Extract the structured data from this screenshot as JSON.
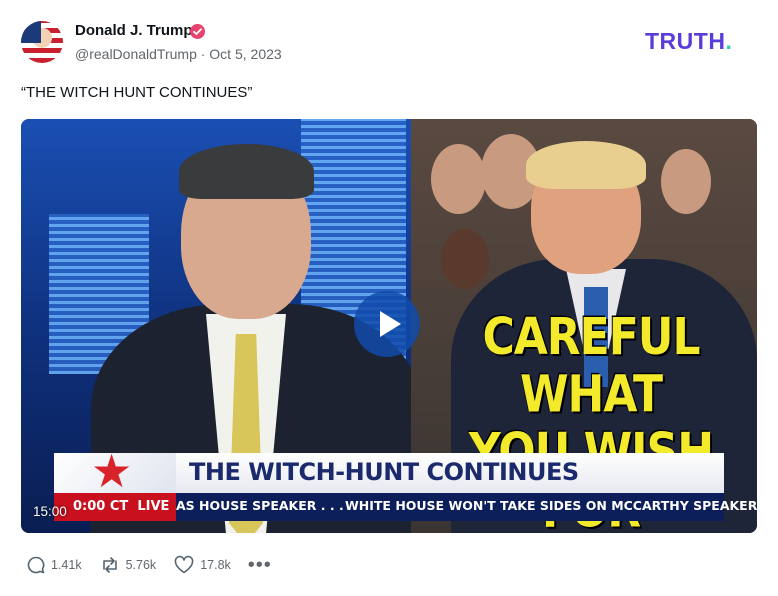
{
  "post": {
    "author_name": "Donald J. Trump",
    "handle_line": "@realDonaldTrump · Oct 5, 2023",
    "text": "“THE WITCH HUNT CONTINUES”",
    "verified_color": "#e7436f"
  },
  "brand": {
    "logo_text": "TRUTH",
    "logo_dot": ".",
    "logo_color": "#5a3dd8",
    "dot_color": "#29d3b5"
  },
  "video": {
    "duration": "15:00",
    "headline_line1": "CAREFUL WHAT",
    "headline_line2": "YOU WISH FOR",
    "banner_title": "THE WITCH-HUNT CONTINUES",
    "live_time": "0:00 CT",
    "live_label": "LIVE",
    "ticker_1": "AS HOUSE SPEAKER . . .",
    "ticker_2": "WHITE HOUSE WON'T TAKE SIDES ON MCCARTHY SPEAKERS",
    "play_icon": "play-icon"
  },
  "actions": {
    "replies": "1.41k",
    "retruths": "5.76k",
    "likes": "17.8k",
    "more": "•••"
  }
}
